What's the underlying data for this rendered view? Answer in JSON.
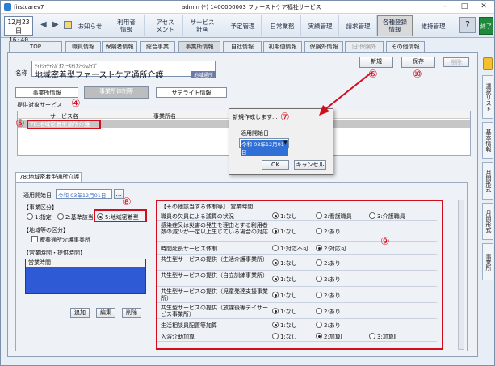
{
  "window": {
    "title": "admin (*) 1400000003 ファーストケア福祉サービス",
    "app": "firstcarev7"
  },
  "clock": {
    "date": "12月23日",
    "time": "16:40"
  },
  "toolbar": [
    {
      "label": "お知らせ"
    },
    {
      "label": "利用者\n情報"
    },
    {
      "label": "アセス\nメント"
    },
    {
      "label": "サービス\n計画"
    },
    {
      "label": "予定管理"
    },
    {
      "label": "日常業務"
    },
    {
      "label": "実績管理"
    },
    {
      "label": "請求管理"
    },
    {
      "label": "各種登録\n情報"
    },
    {
      "label": "維持管理"
    }
  ],
  "help_label": "?",
  "exit_label": "終了",
  "tabs": [
    "TOP",
    "職員情報",
    "保険者情報",
    "総合事業",
    "事業所情報",
    "自社情報",
    "初期値情報",
    "保険外情報",
    "旧:保険外",
    "その他情報"
  ],
  "name": {
    "label": "名称",
    "kana": "ﾃｨｷｼｬﾁｬｸｶﾞﾀﾌｧｰｽﾄｹｱﾂｳｼｮｶｲｺﾞ",
    "value": "地域密着型ファーストケア通所介護",
    "badge": "地域通所"
  },
  "actions": {
    "new": "新規",
    "save": "保存",
    "delete": "削除"
  },
  "subtabs": [
    "事業所情報",
    "事業所体制等",
    "サテライト情報"
  ],
  "service_list": {
    "title": "提供対象サービス",
    "col1": "サービス名",
    "col2": "事業所名",
    "row": "78:地域密着型通所介護"
  },
  "dialog": {
    "title": "新規作成します...",
    "date_label": "適用開始日",
    "date_value": "令和 03年12月01日",
    "ok": "OK",
    "cancel": "キャンセル"
  },
  "section_tab": "78:地域密着型通所介護",
  "start_date": {
    "label": "適用開始日",
    "value": "令和 03年12月01日"
  },
  "jigyo_kubun": {
    "label": "【事業区分】",
    "opt1": "1:指定",
    "opt2": "2:基準該当",
    "opt3": "5:地域密着型"
  },
  "renkei": {
    "label": "【地域等の区分】",
    "check": "療養通所介護事業所"
  },
  "hours": {
    "label": "【営業時間・提供時間】",
    "header": "営業時間",
    "add": "追加",
    "edit": "編集",
    "delete": "削除"
  },
  "taisei": {
    "title": "【その他該当する体制等】 営業時間",
    "rows": [
      {
        "label": "職員の欠員による減算の状況",
        "a": "1:なし",
        "b": "2:看護職員",
        "c": "3:介護職員",
        "sel": "a"
      },
      {
        "label": "感染症又は災害の発生を理由とする利用者数の減少が一定以上生じている場合の対応",
        "a": "1:なし",
        "b": "2:あり",
        "c": "",
        "sel": "a"
      },
      {
        "label": "時間延長サービス体制",
        "a": "1:対応不可",
        "b": "2:対応可",
        "c": "",
        "sel": "b"
      },
      {
        "label": "共生型サービスの提供（生活介護事業所）",
        "a": "1:なし",
        "b": "2:あり",
        "c": "",
        "sel": "a"
      },
      {
        "label": "共生型サービスの提供（自立訓練事業所）",
        "a": "1:なし",
        "b": "2:あり",
        "c": "",
        "sel": "a"
      },
      {
        "label": "共生型サービスの提供（児童発達支援事業所）",
        "a": "1:なし",
        "b": "2:あり",
        "c": "",
        "sel": "a"
      },
      {
        "label": "共生型サービスの提供（放課後等デイサービス事業所）",
        "a": "1:なし",
        "b": "2:あり",
        "c": "",
        "sel": "a"
      },
      {
        "label": "生活相談員配置等加算",
        "a": "1:なし",
        "b": "2:あり",
        "c": "",
        "sel": "a"
      },
      {
        "label": "入浴介助加算",
        "a": "1:なし",
        "b": "2:加算Ⅰ",
        "c": "3:加算Ⅱ",
        "sel": "b"
      }
    ]
  },
  "side_tabs": [
    "選択リスト",
    "基本情報",
    "月間形式",
    "月間形式",
    "事業所"
  ],
  "annotations": [
    "④",
    "⑤",
    "⑥",
    "⑦",
    "⑧",
    "⑨",
    "⑩"
  ],
  "colors": {
    "accent_red": "#d20d1d",
    "selected_row": "#c6c6c6",
    "list_blue": "#2e5ad6"
  }
}
